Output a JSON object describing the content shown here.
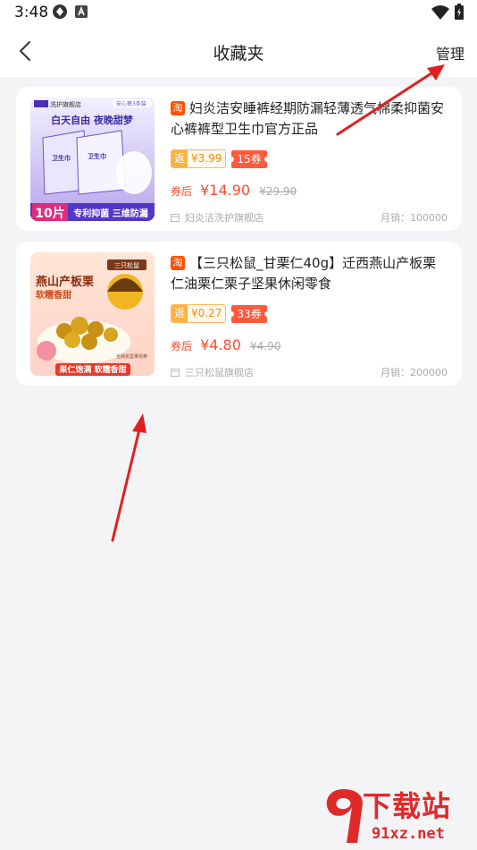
{
  "status_bar": {
    "time": "3:48"
  },
  "header": {
    "title": "收藏夹",
    "manage_label": "管理"
  },
  "favorites": [
    {
      "platform_badge": "淘",
      "title": "妇炎洁安睡裤经期防漏轻薄透气棉柔抑菌安心裤裤型卫生巾官方正品",
      "rebate_label": "返",
      "rebate_value": "¥3.99",
      "coupon": "15券",
      "after_coupon_label": "券后",
      "price": "¥14.90",
      "original_price": "¥29.90",
      "store": "妇炎洁洗护旗舰店",
      "sales": "月销：100000",
      "thumb": {
        "store_tag": "洗护旗舰店",
        "corner_tag": "安心裤3条装",
        "headline": "白天自由 夜晚甜梦",
        "pack_text": "卫生巾",
        "count": "10片",
        "banner": "专利抑菌 三维防漏"
      }
    },
    {
      "platform_badge": "淘",
      "title": "【三只松鼠_甘栗仁40g】迁西燕山产板栗仁油栗仁栗子坚果休闲零食",
      "rebate_label": "返",
      "rebate_value": "¥0.27",
      "coupon": "33券",
      "after_coupon_label": "券后",
      "price": "¥4.80",
      "original_price": "¥4.90",
      "store": "三只松鼠旗舰店",
      "sales": "月销：200000",
      "thumb": {
        "brand": "三只松鼠",
        "headline": "燕山产板栗",
        "subhead": "软糯香甜",
        "promo": "全网买坚果领券",
        "banner": "果仁饱满 软糯香甜"
      }
    }
  ],
  "watermark": {
    "top": "下载站",
    "bottom": "91xz.net"
  },
  "colors": {
    "accent": "#ff4a2b",
    "rebate": "#ffb040",
    "arrow": "#e02020",
    "background": "#f4f4f6"
  }
}
